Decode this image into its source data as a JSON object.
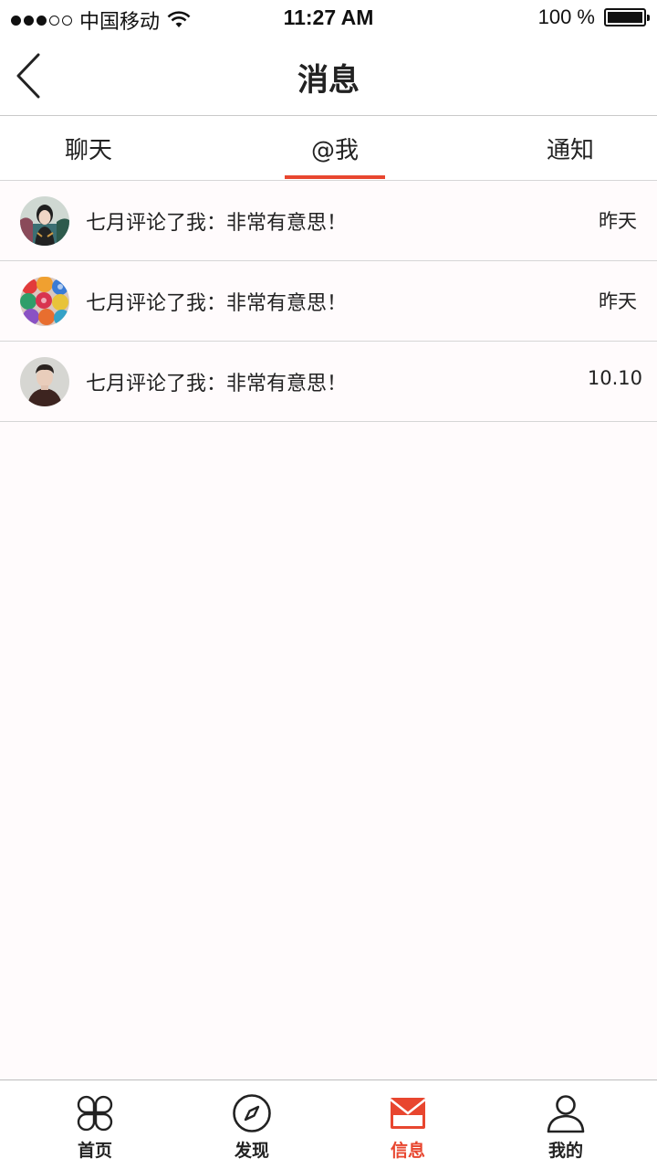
{
  "status_bar": {
    "carrier": "中国移动",
    "time": "11:27 AM",
    "battery": "100 %",
    "signal_bars_filled": 3,
    "signal_bars_total": 5,
    "battery_level": 1.0
  },
  "nav": {
    "title": "消息",
    "back_icon": "chevron-left-icon"
  },
  "tabs": {
    "items": [
      {
        "label": "聊天"
      },
      {
        "label": "@我"
      },
      {
        "label": "通知"
      }
    ],
    "active_index": 1,
    "accent_color": "#e8462f"
  },
  "messages": [
    {
      "text": "七月评论了我：非常有意思！",
      "time": "昨天"
    },
    {
      "text": "七月评论了我：非常有意思！",
      "time": "昨天"
    },
    {
      "text": "七月评论了我：非常有意思！",
      "time": "10.10"
    }
  ],
  "tab_bar": {
    "items": [
      {
        "label": "首页",
        "icon": "clover-icon"
      },
      {
        "label": "发现",
        "icon": "compass-icon"
      },
      {
        "label": "信息",
        "icon": "mail-icon"
      },
      {
        "label": "我的",
        "icon": "person-icon"
      }
    ],
    "active_index": 2,
    "active_color": "#e8462f"
  }
}
